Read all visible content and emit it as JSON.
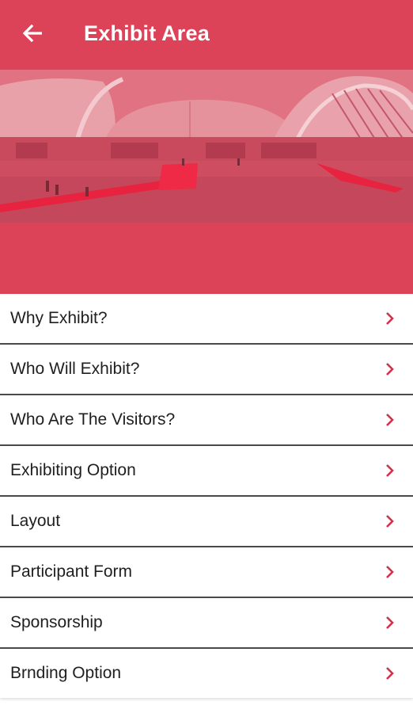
{
  "header": {
    "title": "Exhibit Area",
    "back_icon": "arrow-left-icon"
  },
  "banner": {
    "alt": "exhibition-hall-photo"
  },
  "menu": {
    "chevron_icon": "chevron-right-icon",
    "items": [
      {
        "label": "Why Exhibit?"
      },
      {
        "label": "Who Will Exhibit?"
      },
      {
        "label": "Who Are The Visitors?"
      },
      {
        "label": "Exhibiting Option"
      },
      {
        "label": "Layout"
      },
      {
        "label": "Participant Form"
      },
      {
        "label": "Sponsorship"
      },
      {
        "label": "Brnding Option"
      }
    ]
  },
  "colors": {
    "primary": "#dc4359",
    "chevron": "#d6304a",
    "text": "#1f1f1f",
    "divider": "#4a4a4a"
  }
}
